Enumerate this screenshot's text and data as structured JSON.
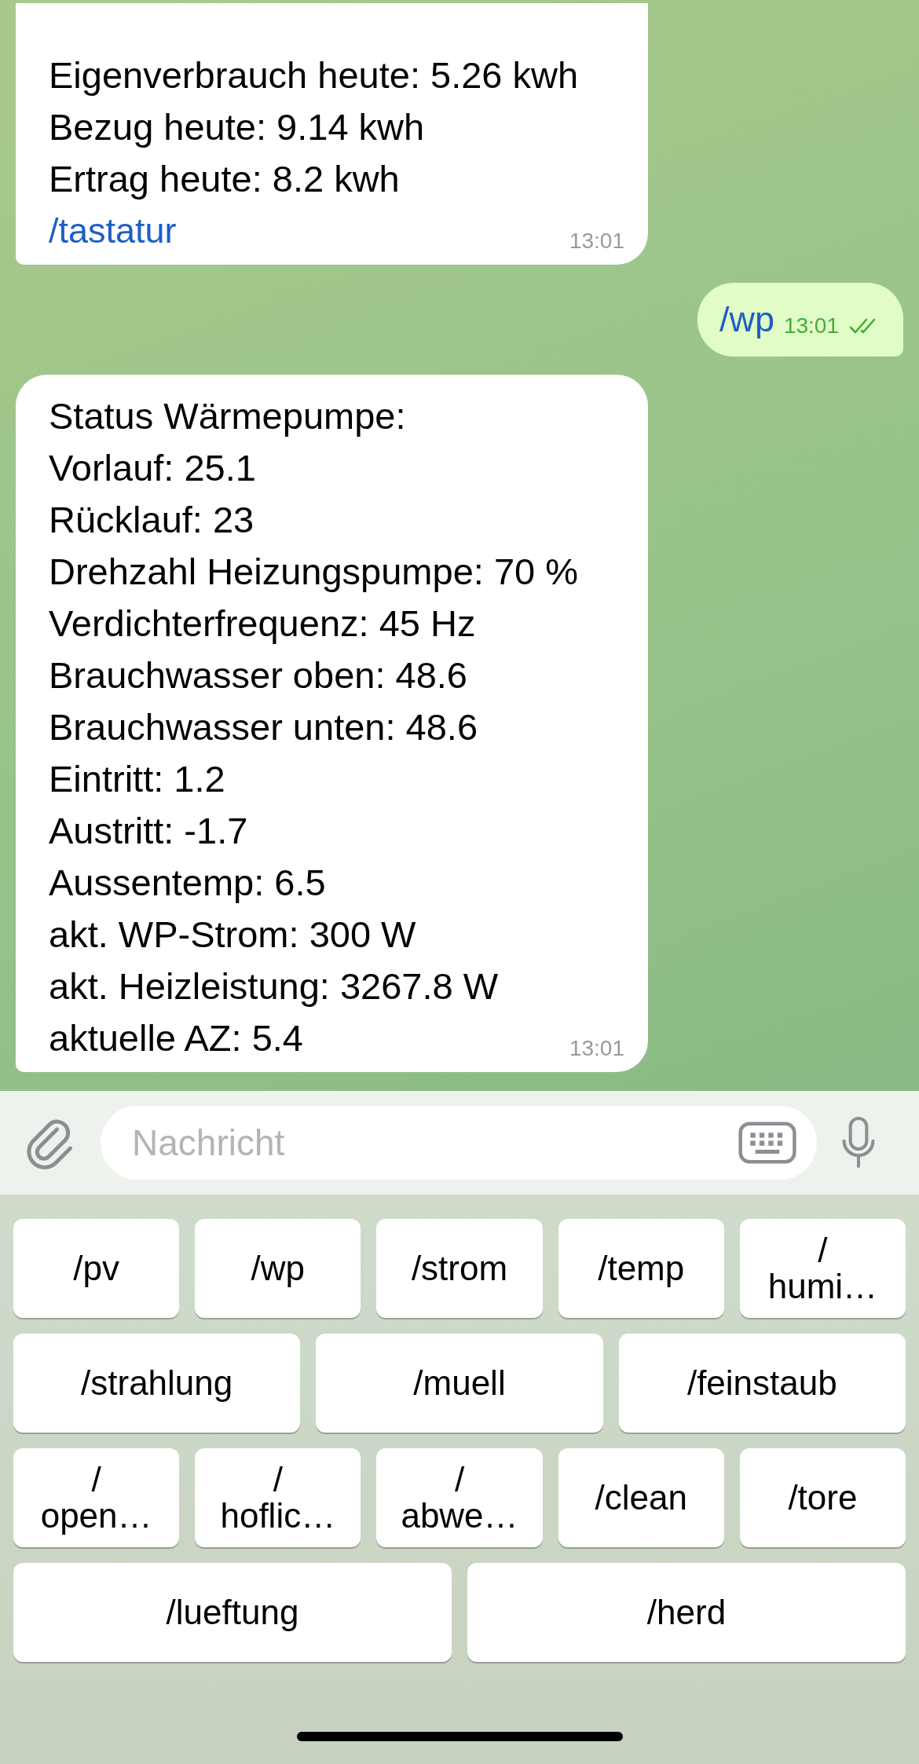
{
  "messages": [
    {
      "kind": "incoming",
      "lines": [
        "Eigenverbrauch heute: 5.26 kwh",
        "Bezug heute: 9.14 kwh",
        "Ertrag heute: 8.2 kwh"
      ],
      "link": "/tastatur",
      "time": "13:01"
    },
    {
      "kind": "outgoing",
      "link": "/wp",
      "time": "13:01",
      "read": true
    },
    {
      "kind": "incoming",
      "lines": [
        "Status Wärmepumpe:",
        "Vorlauf: 25.1",
        "Rücklauf: 23",
        "Drehzahl Heizungspumpe: 70 %",
        "Verdichterfrequenz: 45 Hz",
        "Brauchwasser oben: 48.6",
        "Brauchwasser unten: 48.6",
        "Eintritt: 1.2",
        "Austritt: -1.7",
        "Aussentemp: 6.5",
        "akt. WP-Strom: 300 W",
        "akt. Heizleistung: 3267.8 W",
        "aktuelle AZ: 5.4"
      ],
      "time": "13:01"
    }
  ],
  "composer": {
    "placeholder": "Nachricht"
  },
  "keyboard": {
    "rows": [
      {
        "buttons": [
          "/pv",
          "/wp",
          "/strom",
          "/temp",
          "/\nhumi…"
        ]
      },
      {
        "buttons": [
          "/strahlung",
          "/muell",
          "/feinstaub"
        ]
      },
      {
        "buttons": [
          "/\nopen…",
          "/\nhoflic…",
          "/\nabwe…",
          "/clean",
          "/tore"
        ]
      },
      {
        "buttons": [
          "/lueftung",
          "/herd"
        ]
      }
    ]
  }
}
